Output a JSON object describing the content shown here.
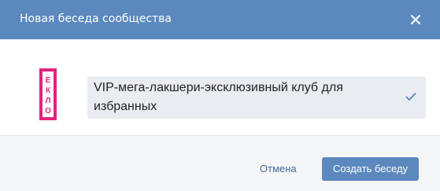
{
  "dialog": {
    "title": "Новая беседа сообщества",
    "close_icon": "close-icon"
  },
  "chat": {
    "logo_text": "ЕКЛО",
    "logo_color": "#e2237e",
    "name_value": "VIP-мега-лакшери-эксклюзивный клуб для избранных",
    "confirm_icon": "check-icon",
    "check_color": "#5b88bd"
  },
  "footer": {
    "cancel_label": "Отмена",
    "create_label": "Создать беседу"
  },
  "colors": {
    "header_bg": "#5b88bd",
    "primary_button": "#5b88bd",
    "link": "#3d6b9f",
    "field_bg": "#e9ecf1",
    "footer_bg": "#f5f6f8"
  }
}
